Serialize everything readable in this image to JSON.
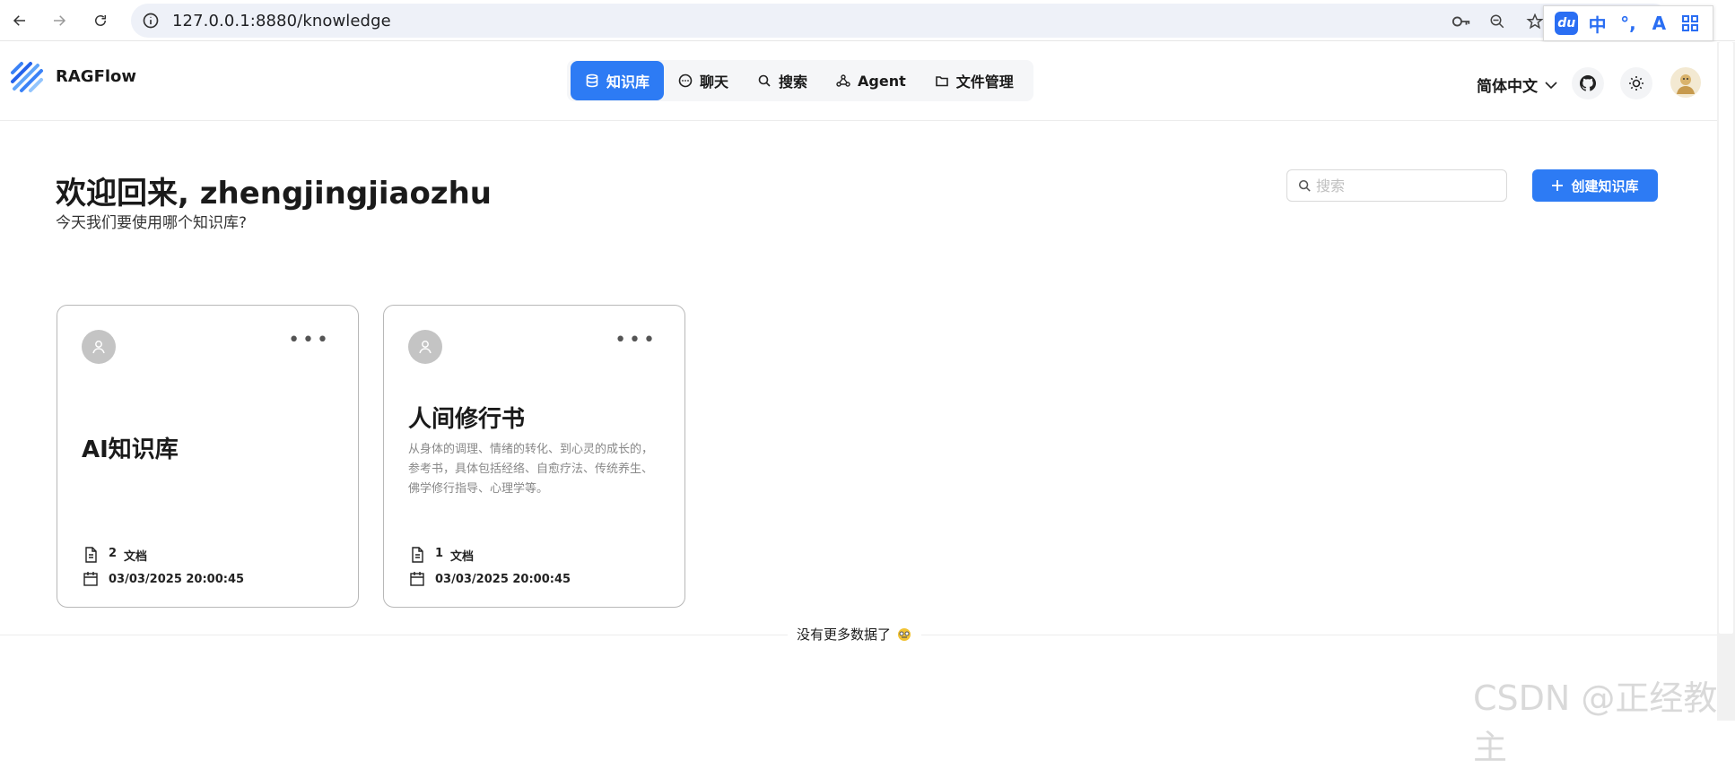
{
  "browser": {
    "url": "127.0.0.1:8880/knowledge",
    "ime": {
      "du": "du",
      "mode": "中",
      "punct": "°,",
      "skin": "A"
    }
  },
  "header": {
    "brand": "RAGFlow",
    "nav": [
      {
        "label": "知识库",
        "icon": "database-icon",
        "active": true
      },
      {
        "label": "聊天",
        "icon": "chat-icon",
        "active": false
      },
      {
        "label": "搜索",
        "icon": "search-icon",
        "active": false
      },
      {
        "label": "Agent",
        "icon": "agent-graph-icon",
        "active": false
      },
      {
        "label": "文件管理",
        "icon": "folder-icon",
        "active": false
      }
    ],
    "language": "简体中文"
  },
  "main": {
    "welcome": "欢迎回来, zhengjingjiaozhu",
    "subtitle": "今天我们要使用哪个知识库?",
    "search_placeholder": "搜索",
    "create_label": "创建知识库",
    "cards": [
      {
        "title": "AI知识库",
        "description": "",
        "doc_count": "2",
        "doc_label": "文档",
        "date": "03/03/2025 20:00:45"
      },
      {
        "title": "人间修行书",
        "description": "从身体的调理、情绪的转化、到心灵的成长的，参考书，具体包括经络、自愈疗法、传统养生、佛学修行指导、心理学等。",
        "doc_count": "1",
        "doc_label": "文档",
        "date": "03/03/2025 20:00:45"
      }
    ],
    "no_more": "没有更多数据了"
  },
  "watermark": "CSDN @正经教主",
  "colors": {
    "accent": "#2d7bf4"
  }
}
